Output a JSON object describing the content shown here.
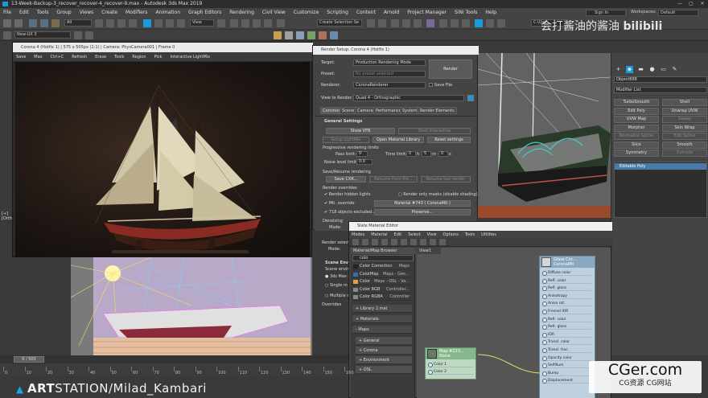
{
  "window": {
    "title": "13-Week-Backup-3_recover_recover-4_recover-9.max - Autodesk 3ds Max 2019",
    "sign_in": "Sign In",
    "workspaces_label": "Workspaces:",
    "workspace_value": "Default"
  },
  "menu": [
    "File",
    "Edit",
    "Tools",
    "Group",
    "Views",
    "Create",
    "Modifiers",
    "Animation",
    "Graph Editors",
    "Rendering",
    "Civil View",
    "Customize",
    "Scripting",
    "Content",
    "Arnold",
    "Project Manager",
    "SiNi Tools",
    "Help"
  ],
  "toolbar": {
    "filter_dropdown": "All",
    "view_dropdown": "View",
    "selection_set": "Create Selection Se",
    "layer_dropdown": "New-UX 3",
    "path_dropdown": "C:\\Use"
  },
  "vfb": {
    "title": "Corona 4 (Hotfix 1) | 575 x 505px (1:1) | Camera: PhysCamera001 | Frame 0",
    "toolbar": [
      "Save",
      "Max",
      "Ctrl+C",
      "Refresh",
      "Erase",
      "Tools",
      "Region",
      "Pick",
      "Interactive LightMix"
    ]
  },
  "render_setup": {
    "title": "Render Setup: Corona 4 (Hotfix 1)",
    "target_label": "Target:",
    "target_value": "Production Rendering Mode",
    "preset_label": "Preset:",
    "preset_value": "No preset selected",
    "renderer_label": "Renderer:",
    "renderer_value": "CoronaRenderer",
    "save_file": "Save File",
    "view_label": "View to Render:",
    "view_value": "Quad 4 - Orthographic",
    "render_button": "Render",
    "tabs": [
      "Common",
      "Scene",
      "Camera",
      "Performance",
      "System",
      "Render Elements"
    ],
    "general_settings": "General Settings",
    "show_vfb": "Show VFB",
    "start_interactive": "Start Interactive",
    "setup_lightmix": "Setup LightMix",
    "open_material_library": "Open Material Library",
    "reset_settings": "Reset settings",
    "progressive_limits": "Progressive rendering limits",
    "pass_limit_label": "Pass limit:",
    "pass_limit_value": "0",
    "time_limit_label": "Time limit:",
    "time_limit_h": "0",
    "time_limit_h_unit": "h",
    "time_limit_m": "5",
    "time_limit_m_unit": "m",
    "time_limit_s": "0",
    "time_limit_s_unit": "s",
    "noise_label": "Noise level limit:",
    "noise_value": "0.0",
    "save_resume": "Save/Resume rendering",
    "save_cxr": "Save CXR...",
    "resume_from_file": "Resume from file...",
    "resume_last": "Resume last render",
    "render_overrides": "Render overrides",
    "render_hidden_lights": "Render hidden lights",
    "render_only_masks": "Render only masks (disable shading)",
    "mtl_override_label": "Mtl. override:",
    "mtl_override_value": "Material #743  ( CoronaMtl )",
    "objects_excluded": "718 objects excluded...",
    "preserve": "Preserve...",
    "denoising": "Denoising",
    "mode_label": "Mode:",
    "render_selected": "Render selecte",
    "mode2_label": "Mode:",
    "scene_env": "Scene Env",
    "scene_env_sub": "Scene environ",
    "max_sc": "3ds Max s",
    "single_m": "Single m",
    "multiple_m": "Multiple m",
    "overrides": "Overrides"
  },
  "command_panel": {
    "object_name": "Object888",
    "modifier_list": "Modifier List",
    "buttons": [
      "TurboSmooth",
      "Shell",
      "Edit Poly",
      "Unwrap UVW",
      "UVW Map",
      "Sweep",
      "Morpher",
      "Skin Wrap",
      "Normalize Spline",
      "Edit Spline",
      "Slice",
      "Smooth",
      "Symmetry",
      "Extrude"
    ],
    "stack_item": "Editable Poly"
  },
  "slate": {
    "title": "Slate Material Editor",
    "menu": [
      "Modes",
      "Material",
      "Edit",
      "Select",
      "View",
      "Options",
      "Tools",
      "Utilities"
    ],
    "browser_title": "Material/Map Browser",
    "search_value": "colo",
    "view_tab": "View1",
    "items": [
      {
        "name": "Color Correction",
        "tag": "Maps"
      },
      {
        "name": "ColorMap",
        "tag": "Maps - Gen..."
      },
      {
        "name": "Color",
        "tag": "Maps - OSL - Va..."
      },
      {
        "name": "Color RGB",
        "tag": "Controller..."
      },
      {
        "name": "Color RGBA",
        "tag": "Controller"
      }
    ],
    "categories": [
      "+ Library 2.mat",
      "+ Materials",
      "- Maps"
    ],
    "subcats": [
      "+ General",
      "+ Corona",
      "+ Environment",
      "+ OSL"
    ],
    "node_title": "Glass Cor...",
    "node_sub": "CoronaMtl",
    "node_slots": [
      "Diffuse color",
      "Refl. color",
      "Refl. gloss",
      "Anisotropy",
      "Aniso rot.",
      "Fresnel IOR",
      "Refr. color",
      "Refr. gloss",
      "IOR",
      "Transl. color",
      "Transl. frac.",
      "Opacity color",
      "SelfIllum",
      "Bump",
      "Displacement"
    ],
    "map_node_title": "Map #213...",
    "map_node_sub": "Noise",
    "map_slots": [
      "Color 1",
      "Color 2"
    ]
  },
  "timeline": {
    "frame": "0 / 500",
    "ticks": [
      "0",
      "10",
      "20",
      "30",
      "40",
      "50",
      "60",
      "70",
      "80",
      "90",
      "100",
      "110",
      "120",
      "130",
      "140",
      "150",
      "160"
    ]
  },
  "viewport_label": "[+]\n[Orthog",
  "branding": {
    "artstation_prefix": "ART",
    "artstation_suffix": "STATION/Milad_Kambari",
    "cn_watermark": "会打酱油的酱油",
    "bilibili": "bilibili",
    "cger_main": "CGer.com",
    "cger_sub": "CG资源 CG网站"
  },
  "colors": {
    "accent": "#1a9ad8",
    "node_blue": "#bfd1df",
    "node_green": "#9ec8a4"
  }
}
